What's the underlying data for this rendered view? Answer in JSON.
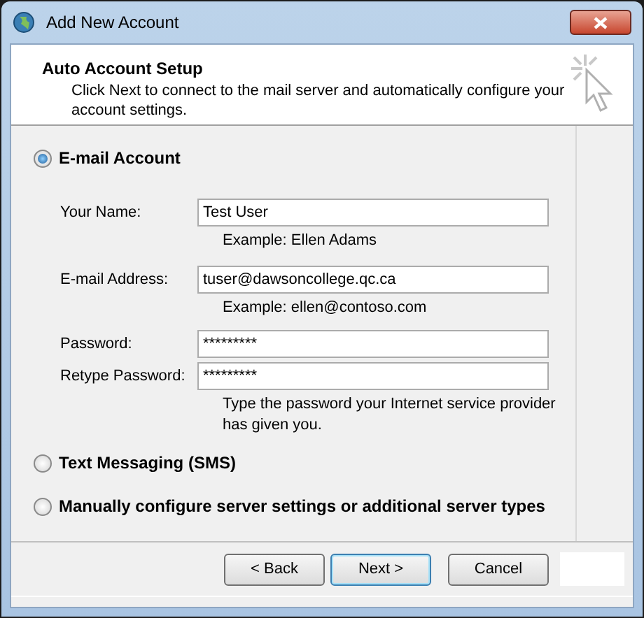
{
  "window": {
    "title": "Add New Account"
  },
  "header": {
    "title": "Auto Account Setup",
    "description": "Click Next to connect to the mail server and automatically configure your account settings."
  },
  "options": [
    {
      "label": "E-mail Account",
      "selected": true
    },
    {
      "label": "Text Messaging (SMS)",
      "selected": false
    },
    {
      "label": "Manually configure server settings or additional server types",
      "selected": false
    }
  ],
  "fields": [
    {
      "label": "Your Name:",
      "value": "Test User",
      "hint": "Example: Ellen Adams"
    },
    {
      "label": "E-mail Address:",
      "value": "tuser@dawsoncollege.qc.ca",
      "hint": "Example: ellen@contoso.com"
    },
    {
      "label": "Password:",
      "value": "*********"
    },
    {
      "label": "Retype Password:",
      "value": "*********",
      "hint": "Type the password your Internet service provider has given you."
    }
  ],
  "buttons": [
    {
      "label": "< Back",
      "default": false
    },
    {
      "label": "Next >",
      "default": true
    },
    {
      "label": "Cancel",
      "default": false
    }
  ]
}
